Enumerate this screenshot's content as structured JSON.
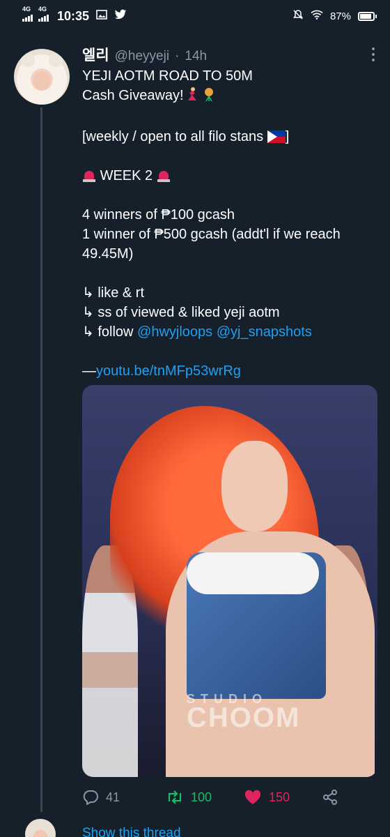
{
  "status_bar": {
    "net1": "4G",
    "net2": "4G",
    "time": "10:35",
    "battery": "87%"
  },
  "tweet": {
    "display_name": "엘리",
    "handle": "@heyyeji",
    "separator": "·",
    "age": "14h",
    "line1": "YEJI AOTM ROAD TO 50M",
    "line2": "Cash Giveaway!",
    "line3a": "[weekly / open to all filo stans",
    "line3b": "]",
    "week": "WEEK 2",
    "prize1": "4 winners of ₱100 gcash",
    "prize2": "1 winner of ₱500 gcash (addt'l if we reach",
    "prize3": "49.45M)",
    "rule1": "↳ like & rt",
    "rule2": "↳ ss of viewed & liked yeji aotm",
    "rule3_prefix": "↳ follow ",
    "mention1": "@hwyjloops",
    "mention2": "@yj_snapshots",
    "link_prefix": "—",
    "link": "youtu.be/tnMFp53wrRg",
    "watermark_top": "STUDIO",
    "watermark": "CHOOM"
  },
  "actions": {
    "replies": "41",
    "retweets": "100",
    "likes": "150"
  },
  "next": {
    "show_thread": "Show this thread"
  },
  "icons": [
    "signal-icon",
    "photo-icon",
    "twitter-bird-icon",
    "mute-icon",
    "wifi-icon",
    "battery-icon",
    "more-icon",
    "reply-icon",
    "retweet-icon",
    "heart-icon",
    "share-icon",
    "siren-icon",
    "flag-ph-icon"
  ],
  "colors": {
    "background": "#15202b",
    "link": "#1da1f2",
    "retweet": "#17bf63",
    "like": "#e0245e",
    "muted": "#8899a6"
  }
}
